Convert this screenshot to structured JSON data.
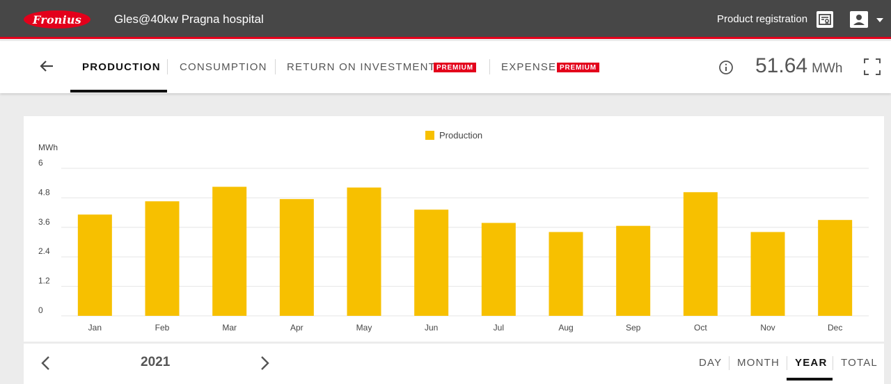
{
  "header": {
    "logo_text": "Fronius",
    "site_title": "Gles@40kw Pragna hospital",
    "product_registration": "Product registration"
  },
  "tabs": [
    {
      "label": "PRODUCTION",
      "active": true
    },
    {
      "label": "CONSUMPTION",
      "active": false
    },
    {
      "label": "RETURN ON INVESTMENT",
      "active": false,
      "badge": "PREMIUM"
    },
    {
      "label": "EXPENSE",
      "active": false,
      "badge": "PREMIUM"
    }
  ],
  "summary": {
    "value": "51.64",
    "unit": "MWh"
  },
  "colors": {
    "accent": "#e3001b",
    "bar": "#f7c000",
    "header": "#474747"
  },
  "icons": {
    "back": "arrow-left-icon",
    "info": "info-icon",
    "fullscreen": "fullscreen-icon",
    "registration": "registration-certificate-icon",
    "user": "user-icon",
    "prev": "chevron-left-icon",
    "next": "chevron-right-icon"
  },
  "chart_data": {
    "type": "bar",
    "ylabel": "MWh",
    "ylim": [
      0,
      6
    ],
    "yticks": [
      "0",
      "1.2",
      "2.4",
      "3.6",
      "4.8",
      "6"
    ],
    "categories": [
      "Jan",
      "Feb",
      "Mar",
      "Apr",
      "May",
      "Jun",
      "Jul",
      "Aug",
      "Sep",
      "Oct",
      "Nov",
      "Dec"
    ],
    "series": [
      {
        "name": "Production",
        "values": [
          4.12,
          4.66,
          5.25,
          4.75,
          5.22,
          4.32,
          3.78,
          3.41,
          3.66,
          5.03,
          3.41,
          3.9
        ]
      }
    ],
    "legend": "top-center",
    "grid": true
  },
  "period": {
    "year": "2021",
    "ranges": [
      {
        "label": "DAY",
        "active": false
      },
      {
        "label": "MONTH",
        "active": false
      },
      {
        "label": "YEAR",
        "active": true
      },
      {
        "label": "TOTAL",
        "active": false
      }
    ]
  }
}
